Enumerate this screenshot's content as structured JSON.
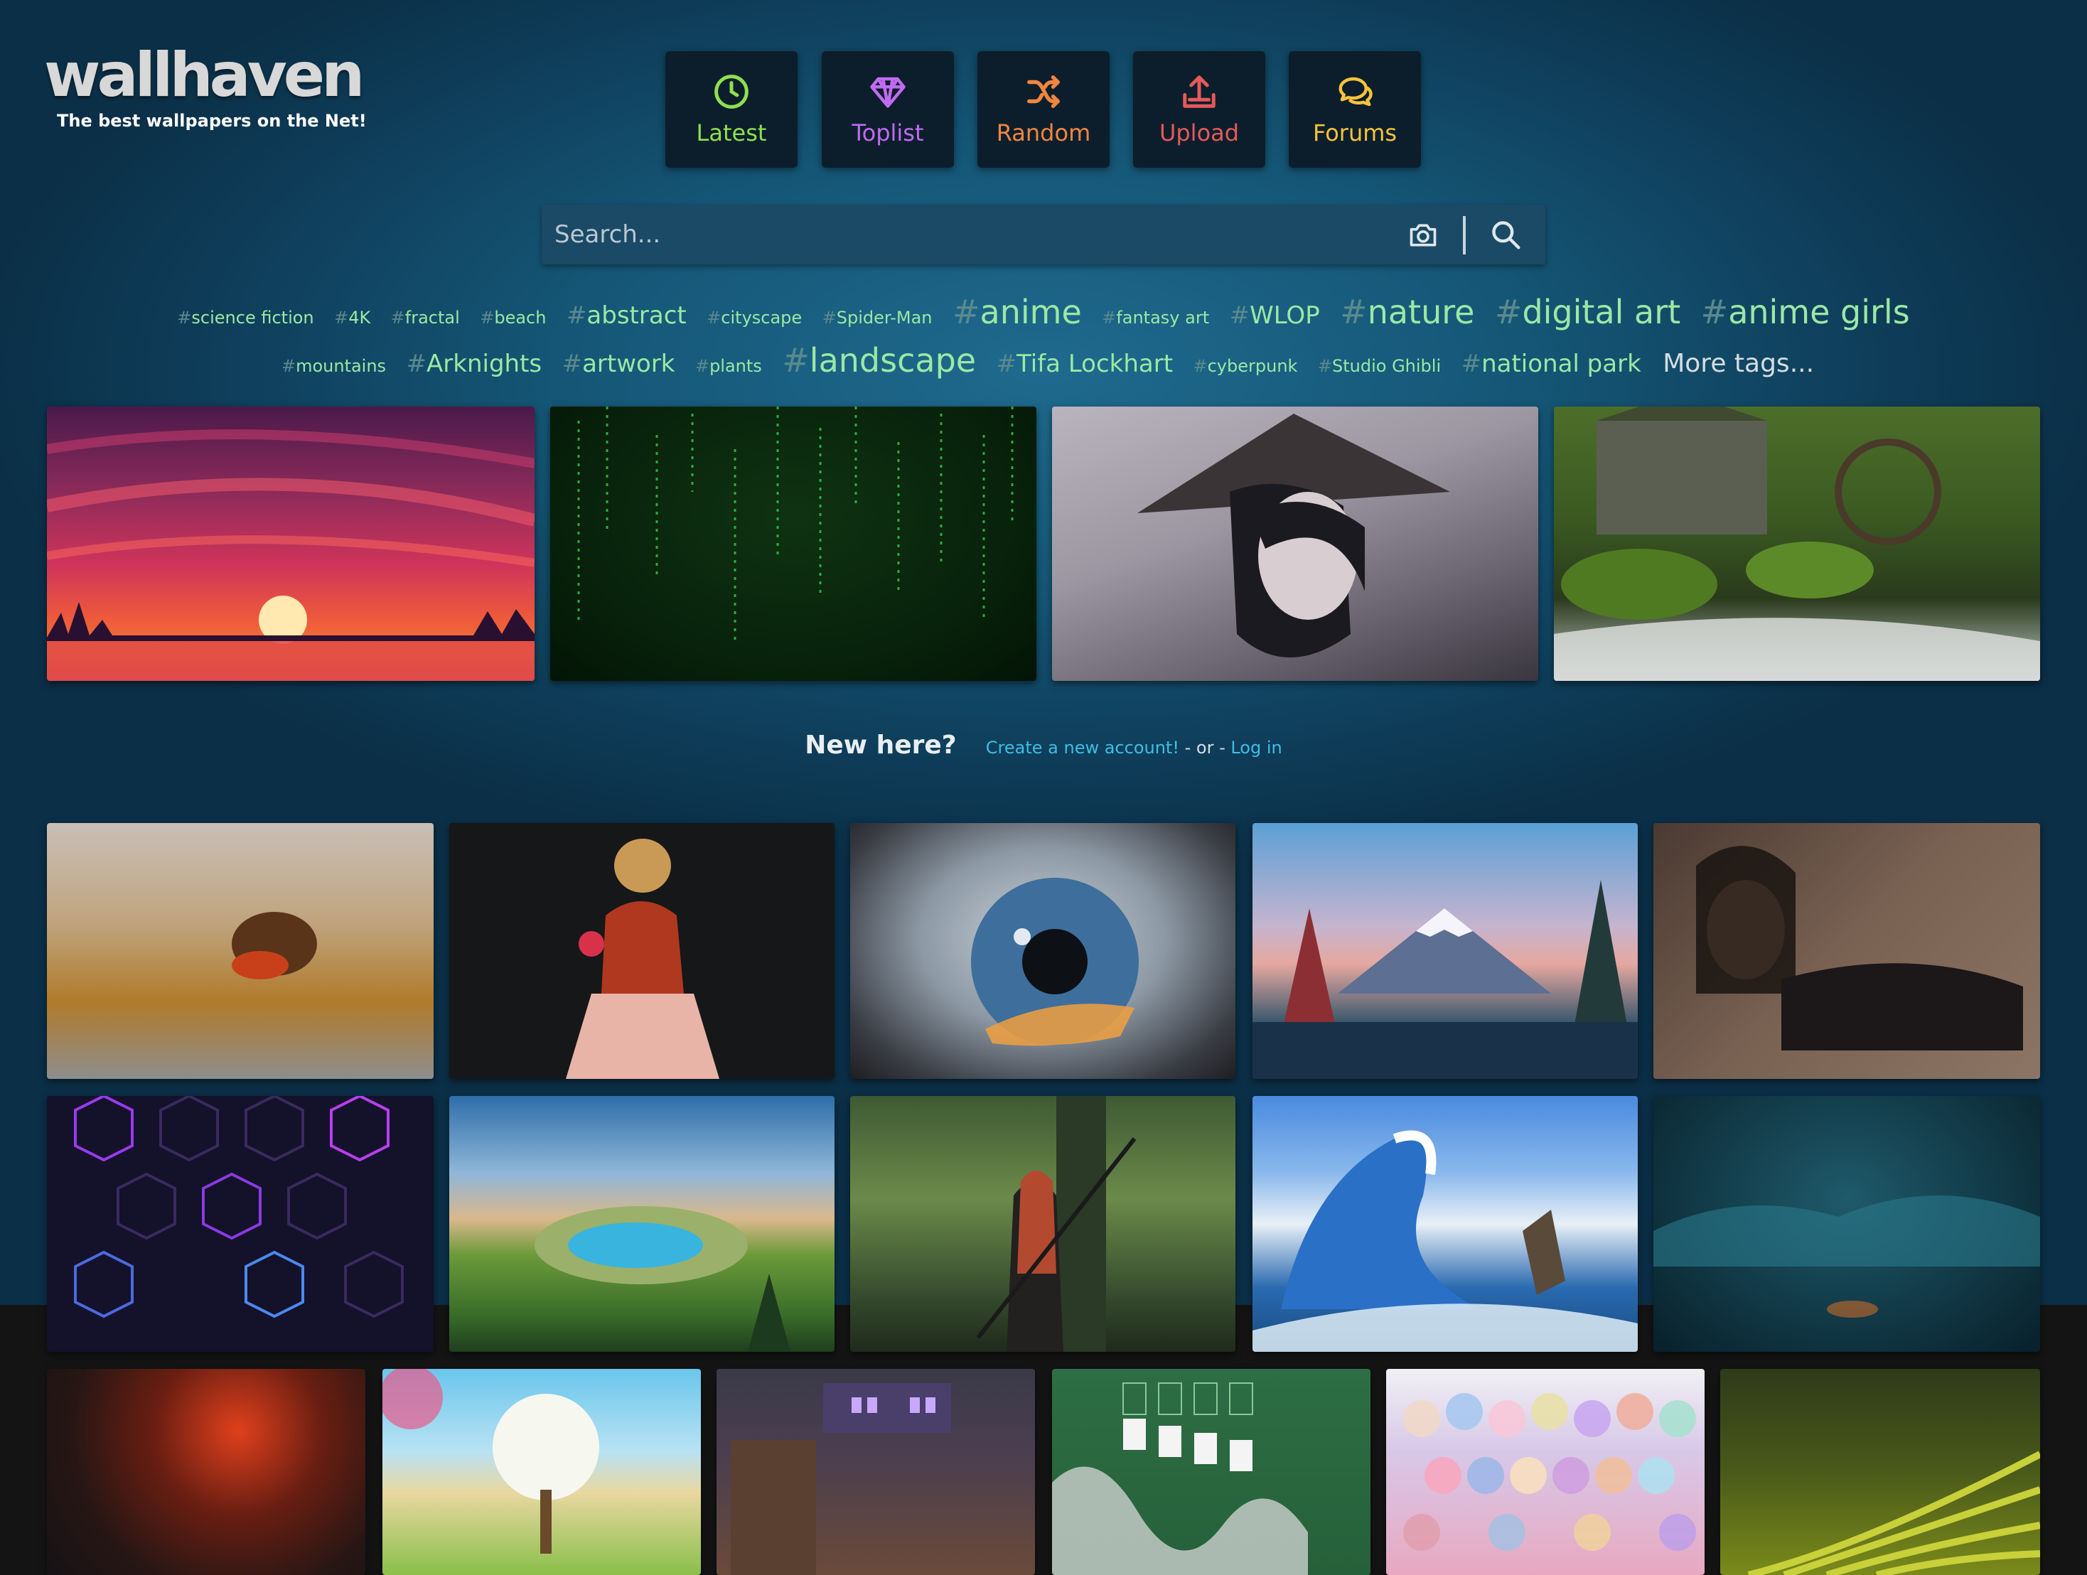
{
  "logo": {
    "title": "wallhaven",
    "tagline": "The best wallpapers on the Net!"
  },
  "nav": [
    {
      "label": "Latest",
      "icon": "clock-icon",
      "color": "#8ee04e"
    },
    {
      "label": "Toplist",
      "icon": "diamond-icon",
      "color": "#c06bf0"
    },
    {
      "label": "Random",
      "icon": "shuffle-icon",
      "color": "#f0863f"
    },
    {
      "label": "Upload",
      "icon": "upload-icon",
      "color": "#e55a5a"
    },
    {
      "label": "Forums",
      "icon": "chat-bubbles-icon",
      "color": "#f5c33b"
    }
  ],
  "search": {
    "placeholder": "Search..."
  },
  "tags": {
    "row1": [
      "science fiction",
      "4K",
      "fractal",
      "beach",
      "abstract",
      "cityscape",
      "Spider-Man",
      "anime",
      "fantasy art",
      "WLOP",
      "nature",
      "digital art",
      "anime girls"
    ],
    "row2": [
      "mountains",
      "Arknights",
      "artwork",
      "plants",
      "landscape",
      "Tifa Lockhart",
      "cyberpunk",
      "Studio Ghibli",
      "national park"
    ],
    "hash": "#",
    "more": "More tags..."
  },
  "new_here": {
    "title": "New here?",
    "create": "Create a new account!",
    "sep": " - or - ",
    "login": "Log in"
  },
  "colors": {
    "tag": "#9be8a4",
    "link": "#3fbde6",
    "background": "#155676"
  }
}
